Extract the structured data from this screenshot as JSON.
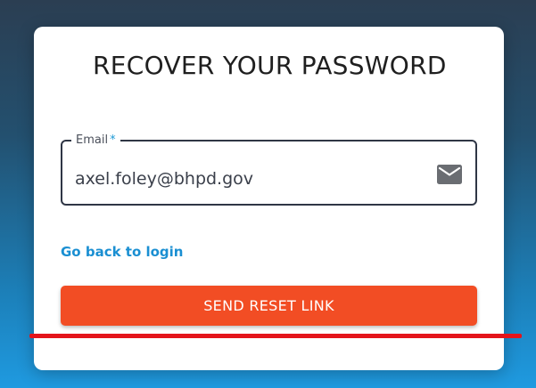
{
  "page": {
    "title": "RECOVER YOUR PASSWORD"
  },
  "form": {
    "email_label": "Email",
    "required_mark": "*",
    "email_value": "axel.foley@bhpd.gov",
    "email_icon": "mail-icon"
  },
  "links": {
    "back_to_login": "Go back to login"
  },
  "actions": {
    "send_reset_label": "SEND RESET LINK"
  },
  "colors": {
    "accent_button": "#f24d24",
    "link": "#1a8fd2",
    "required_mark": "#1f9ad6",
    "annotation_line": "#e4141b"
  }
}
